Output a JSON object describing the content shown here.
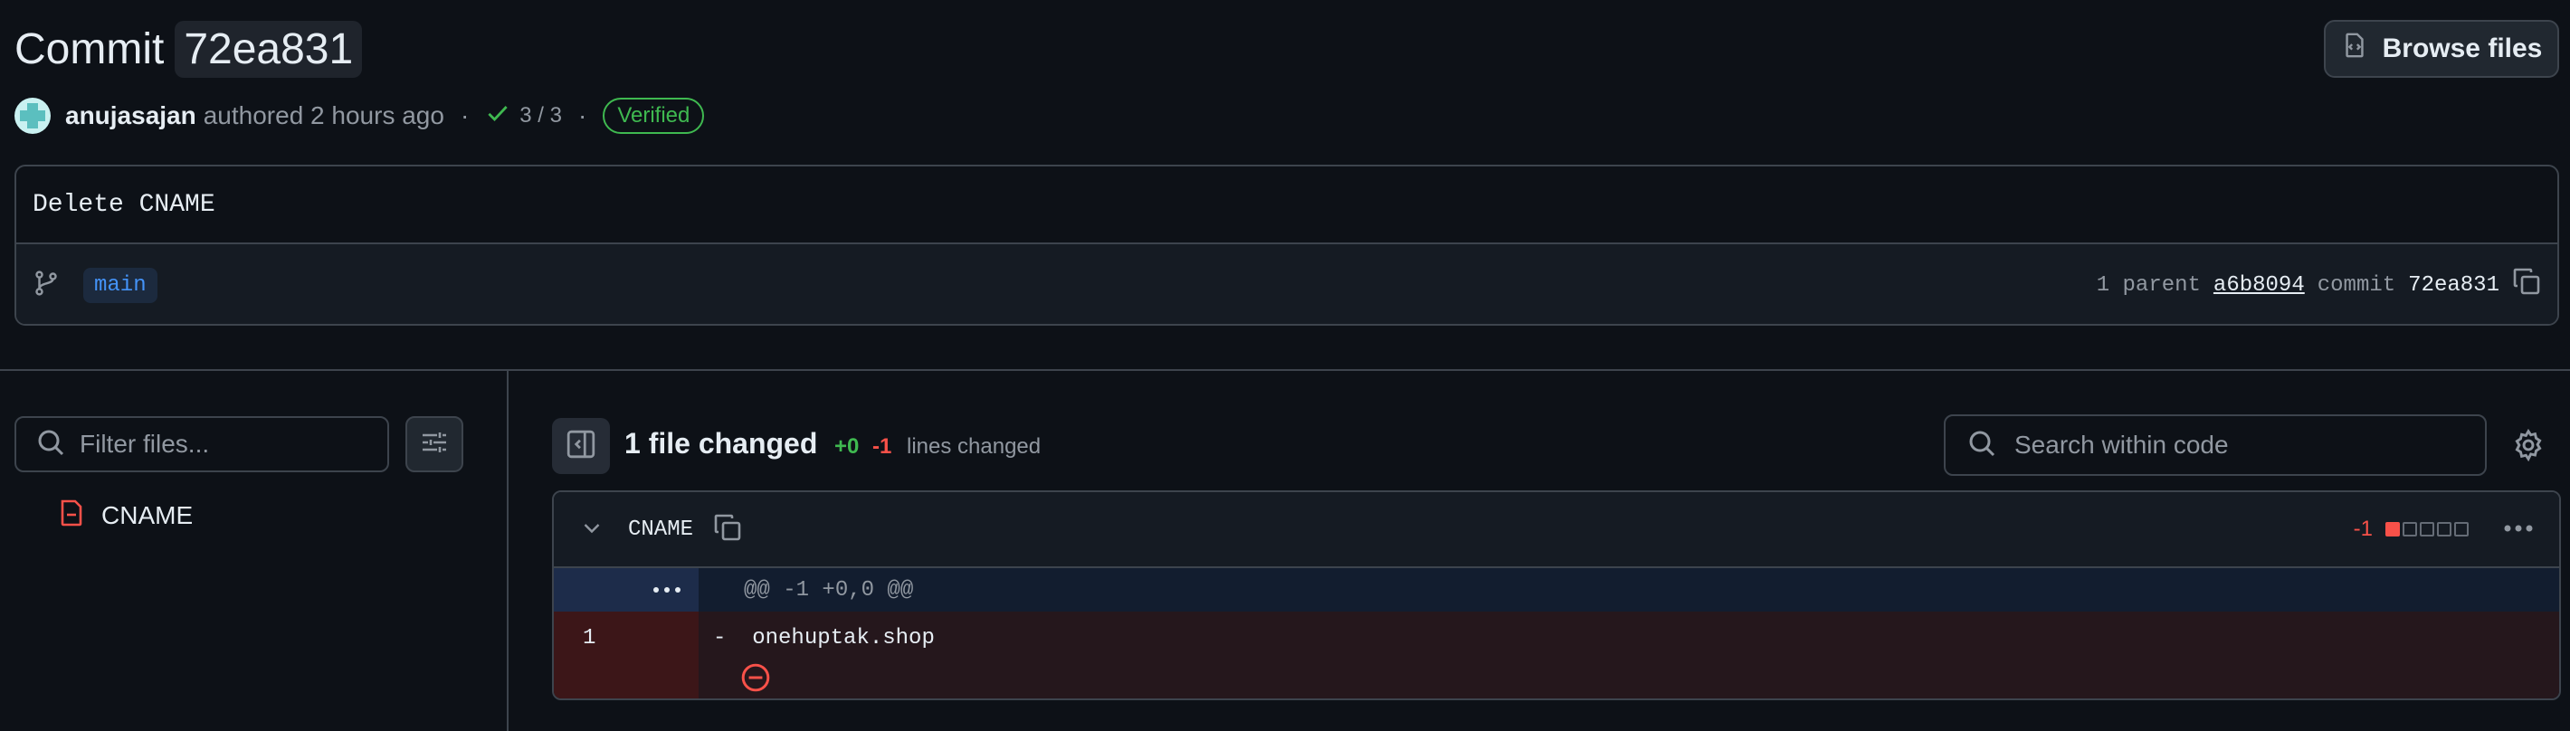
{
  "header": {
    "title_word": "Commit",
    "title_sha": "72ea831",
    "browse_files_label": "Browse files"
  },
  "meta": {
    "author": "anujasajan",
    "authored_text": "authored 2 hours ago",
    "separator": "·",
    "checks": "3 / 3",
    "verified": "Verified"
  },
  "commit": {
    "message": "Delete CNAME",
    "branch": "main",
    "parent_label": "1 parent",
    "parent_sha": "a6b8094",
    "commit_label": "commit",
    "commit_sha": "72ea831"
  },
  "files_panel": {
    "filter_placeholder": "Filter files...",
    "files": [
      {
        "name": "CNAME",
        "status": "deleted"
      }
    ]
  },
  "diff_toolbar": {
    "files_changed": "1 file changed",
    "added": "+0",
    "removed": "-1",
    "lines_changed": "lines changed",
    "search_placeholder": "Search within code"
  },
  "diff": {
    "filename": "CNAME",
    "change_count": "-1",
    "stat_blocks": [
      "red",
      "neutral",
      "neutral",
      "neutral",
      "neutral"
    ],
    "hunk_header": "@@ -1 +0,0 @@",
    "lines": [
      {
        "old_line": "1",
        "prefix": "-",
        "text": "onehuptak.shop"
      }
    ]
  },
  "colors": {
    "background": "#0d1117",
    "border": "#3d444d",
    "added": "#3fb950",
    "removed": "#f85149",
    "accent": "#4493f8"
  }
}
